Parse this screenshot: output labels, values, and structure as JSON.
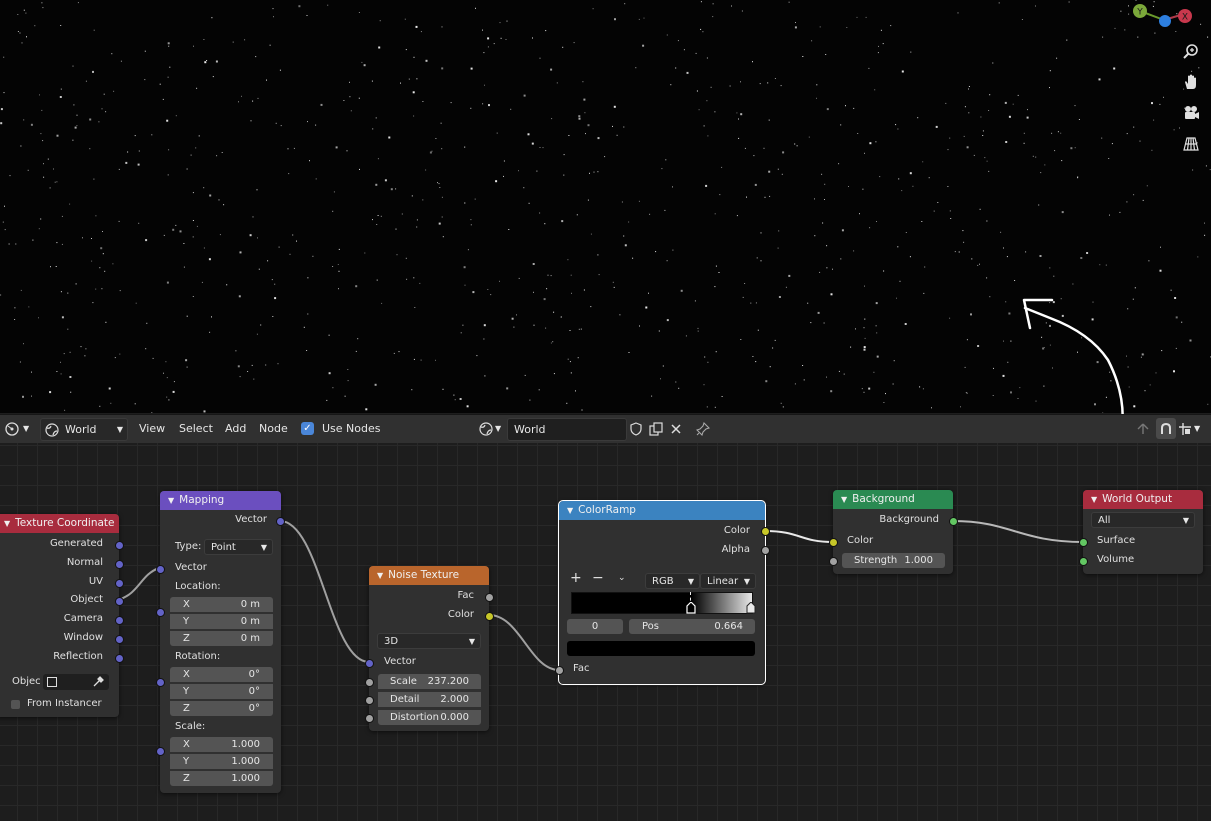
{
  "viewport": {
    "tools": [
      "zoom-icon",
      "hand-pan-icon",
      "camera-icon",
      "grid-perspective-icon"
    ],
    "gizmo": {
      "y": "Y",
      "x": "X"
    }
  },
  "header": {
    "editor_type_icon": "node-editor-icon",
    "shader_type_icon": "world-icon",
    "shader_type": "World",
    "menu": {
      "view": "View",
      "select": "Select",
      "add": "Add",
      "node": "Node"
    },
    "use_nodes_label": "Use Nodes",
    "use_nodes_checked": true,
    "world_name": "World"
  },
  "nodes": {
    "texcoord": {
      "title": "Texture Coordinate",
      "outputs": [
        "Generated",
        "Normal",
        "UV",
        "Object",
        "Camera",
        "Window",
        "Reflection"
      ],
      "object_label": "Objec",
      "from_instancer": "From Instancer"
    },
    "mapping": {
      "title": "Mapping",
      "output": "Vector",
      "type_label": "Type:",
      "type_value": "Point",
      "vector_label": "Vector",
      "location_label": "Location:",
      "location": [
        {
          "axis": "X",
          "value": "0 m"
        },
        {
          "axis": "Y",
          "value": "0 m"
        },
        {
          "axis": "Z",
          "value": "0 m"
        }
      ],
      "rotation_label": "Rotation:",
      "rotation": [
        {
          "axis": "X",
          "value": "0°"
        },
        {
          "axis": "Y",
          "value": "0°"
        },
        {
          "axis": "Z",
          "value": "0°"
        }
      ],
      "scale_label": "Scale:",
      "scale": [
        {
          "axis": "X",
          "value": "1.000"
        },
        {
          "axis": "Y",
          "value": "1.000"
        },
        {
          "axis": "Z",
          "value": "1.000"
        }
      ]
    },
    "noise": {
      "title": "Noise Texture",
      "out_fac": "Fac",
      "out_color": "Color",
      "dimensions": "3D",
      "in_vector": "Vector",
      "scale": {
        "label": "Scale",
        "value": "237.200"
      },
      "detail": {
        "label": "Detail",
        "value": "2.000"
      },
      "distortion": {
        "label": "Distortion",
        "value": "0.000"
      }
    },
    "colorramp": {
      "title": "ColorRamp",
      "out_color": "Color",
      "out_alpha": "Alpha",
      "color_mode": "RGB",
      "interpolation": "Linear",
      "stop_index": "0",
      "pos_label": "Pos",
      "pos_value": "0.664",
      "in_fac": "Fac"
    },
    "background": {
      "title": "Background",
      "output": "Background",
      "in_color": "Color",
      "strength": {
        "label": "Strength",
        "value": "1.000"
      }
    },
    "world_output": {
      "title": "World Output",
      "target": "All",
      "in_surface": "Surface",
      "in_volume": "Volume"
    }
  },
  "colors": {
    "texcoord_header": "#a82c3e",
    "mapping_header": "#6b4fbf",
    "noise_header": "#b9652c",
    "colorramp_header": "#3b83c0",
    "background_header": "#2a8a52",
    "output_header": "#a82c3e"
  }
}
